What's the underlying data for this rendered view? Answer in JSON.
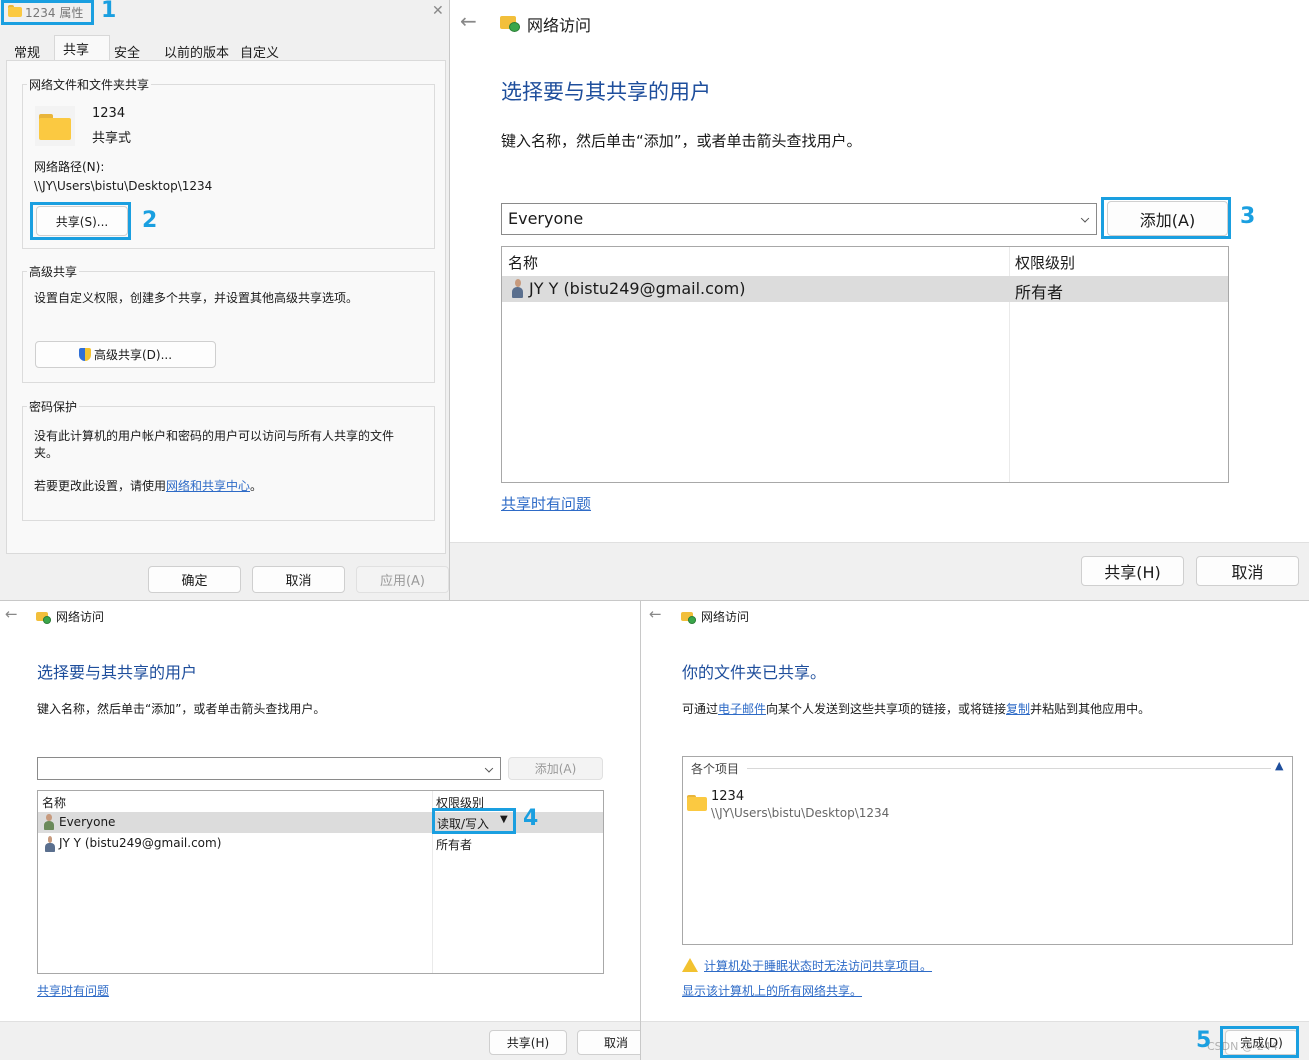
{
  "properties_dialog": {
    "title": "1234 属性",
    "close_glyph": "✕",
    "tabs": [
      "常规",
      "共享",
      "安全",
      "以前的版本",
      "自定义"
    ],
    "net_group_title": "网络文件和文件夹共享",
    "folder_name": "1234",
    "folder_status": "共享式",
    "path_label": "网络路径(N):",
    "path_value": "\\\\JY\\Users\\bistu\\Desktop\\1234",
    "share_button": "共享(S)...",
    "adv_group_title": "高级共享",
    "adv_desc": "设置自定义权限，创建多个共享，并设置其他高级共享选项。",
    "adv_button": "高级共享(D)...",
    "pwd_group_title": "密码保护",
    "pwd_desc_line1": "没有此计算机的用户帐户和密码的用户可以访问与所有人共享的文件",
    "pwd_desc_line2": "夹。",
    "pwd_change_prefix": "若要更改此设置，请使用",
    "pwd_change_link": "网络和共享中心",
    "pwd_change_suffix": "。",
    "ok": "确定",
    "cancel": "取消",
    "apply": "应用(A)"
  },
  "network_access_1": {
    "title": "网络访问",
    "heading": "选择要与其共享的用户",
    "instruction": "键入名称，然后单击“添加”，或者单击箭头查找用户。",
    "combo_value": "Everyone",
    "add_button": "添加(A)",
    "col_name": "名称",
    "col_perm": "权限级别",
    "rows": [
      {
        "name": "JY Y (bistu249@gmail.com)",
        "perm": "所有者"
      }
    ],
    "help_link": "共享时有问题",
    "share_button": "共享(H)",
    "cancel_button": "取消"
  },
  "network_access_2": {
    "title": "网络访问",
    "heading": "选择要与其共享的用户",
    "instruction": "键入名称，然后单击“添加”，或者单击箭头查找用户。",
    "combo_value": "",
    "add_button": "添加(A)",
    "col_name": "名称",
    "col_perm": "权限级别",
    "rows": [
      {
        "name": "Everyone",
        "perm": "读取/写入"
      },
      {
        "name": "JY Y (bistu249@gmail.com)",
        "perm": "所有者"
      }
    ],
    "help_link": "共享时有问题",
    "share_button": "共享(H)",
    "cancel_button": "取消"
  },
  "network_access_3": {
    "title": "网络访问",
    "heading": "你的文件夹已共享。",
    "desc_prefix": "可通过",
    "desc_link1": "电子邮件",
    "desc_mid": "向某个人发送到这些共享项的链接，或将链接",
    "desc_link2": "复制",
    "desc_suffix": "并粘贴到其他应用中。",
    "items_group": "各个项目",
    "item_name": "1234",
    "item_path": "\\\\JY\\Users\\bistu\\Desktop\\1234",
    "warn_link": "计算机处于睡眠状态时无法访问共享项目。",
    "show_all_link": "显示该计算机上的所有网络共享。",
    "done_button": "完成(D)",
    "watermark": "CSDN @-244"
  },
  "annotations": [
    "1",
    "2",
    "3",
    "4",
    "5"
  ],
  "colors": {
    "highlight": "#1a9fe0",
    "link": "#2e6bc7",
    "heading": "#1e4e9c"
  }
}
